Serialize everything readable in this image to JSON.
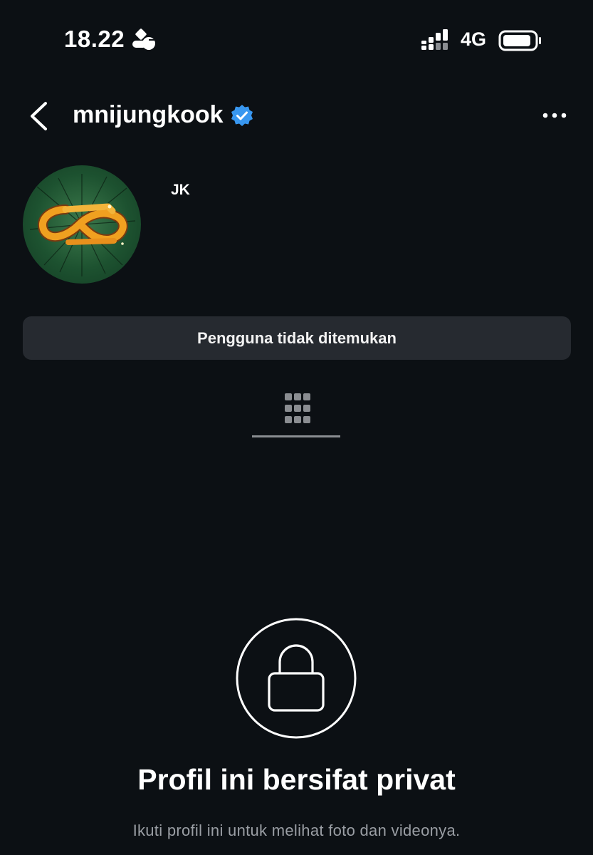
{
  "status_bar": {
    "time": "18.22",
    "network": "4G",
    "icons": [
      "do-not-disturb-icon",
      "signal-icon",
      "battery-icon"
    ]
  },
  "header": {
    "username": "mnijungkook",
    "verified": true,
    "icons": [
      "back-arrow-icon",
      "verified-badge-icon",
      "more-options-icon"
    ]
  },
  "profile": {
    "display_name": "JK",
    "notice": "Pengguna tidak ditemukan"
  },
  "tabs": {
    "active": "grid",
    "icons": [
      "grid-icon"
    ]
  },
  "private_notice": {
    "title": "Profil ini bersifat privat",
    "subtitle": "Ikuti profil ini untuk melihat foto dan videonya.",
    "icon": "lock-icon"
  },
  "colors": {
    "background": "#0c1014",
    "verified_blue": "#3897f0",
    "notice_bg": "#262a30",
    "muted_text": "#9a9ea4"
  }
}
